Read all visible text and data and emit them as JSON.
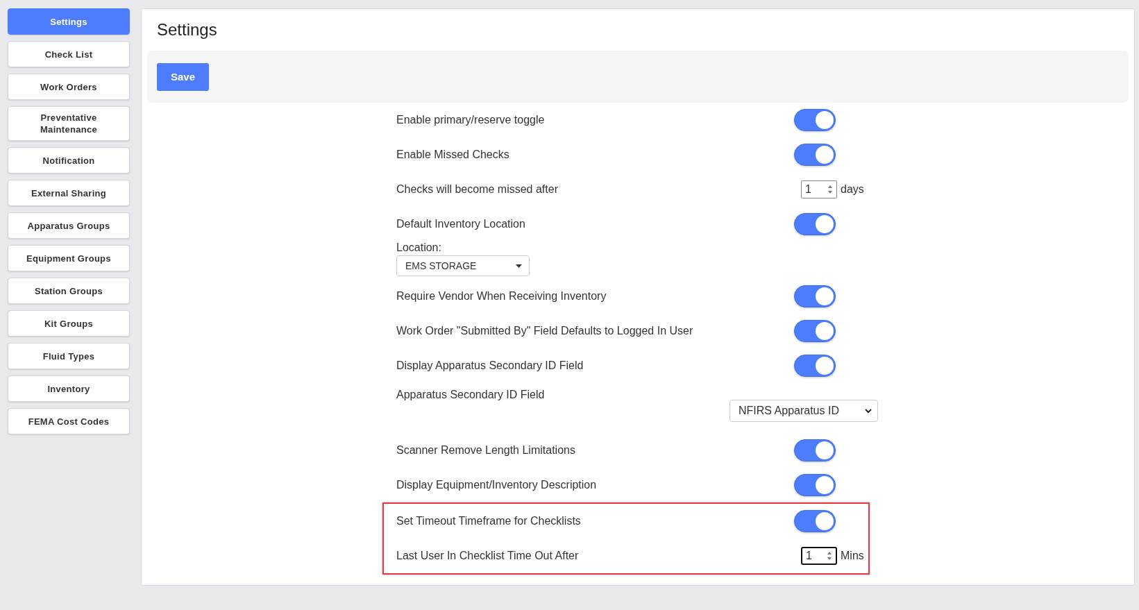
{
  "sidebar": {
    "items": [
      {
        "label": "Settings",
        "selected": true
      },
      {
        "label": "Check List",
        "selected": false
      },
      {
        "label": "Work Orders",
        "selected": false
      },
      {
        "label": "Preventative Maintenance",
        "selected": false
      },
      {
        "label": "Notification",
        "selected": false
      },
      {
        "label": "External Sharing",
        "selected": false
      },
      {
        "label": "Apparatus Groups",
        "selected": false
      },
      {
        "label": "Equipment Groups",
        "selected": false
      },
      {
        "label": "Station Groups",
        "selected": false
      },
      {
        "label": "Kit Groups",
        "selected": false
      },
      {
        "label": "Fluid Types",
        "selected": false
      },
      {
        "label": "Inventory",
        "selected": false
      },
      {
        "label": "FEMA Cost Codes",
        "selected": false
      }
    ]
  },
  "page": {
    "title": "Settings",
    "save_button": "Save"
  },
  "settings": [
    {
      "kind": "toggle",
      "label": "Enable primary/reserve toggle",
      "on": true,
      "highlighted": false
    },
    {
      "kind": "toggle",
      "label": "Enable Missed Checks",
      "on": true,
      "highlighted": false
    },
    {
      "kind": "number",
      "label": "Checks will become missed after",
      "value": "1",
      "unit": "days",
      "focused": false,
      "highlighted": false
    },
    {
      "kind": "toggle",
      "label": "Default Inventory Location",
      "on": true,
      "highlighted": false
    },
    {
      "kind": "dropdown",
      "label": "Location:",
      "value": "EMS STORAGE",
      "highlighted": false
    },
    {
      "kind": "toggle",
      "label": "Require Vendor When Receiving Inventory",
      "on": true,
      "highlighted": false
    },
    {
      "kind": "toggle",
      "label": "Work Order \"Submitted By\" Field Defaults to Logged In User",
      "on": true,
      "highlighted": false
    },
    {
      "kind": "toggle",
      "label": "Display Apparatus Secondary ID Field",
      "on": true,
      "highlighted": false
    },
    {
      "kind": "select",
      "label": "Apparatus Secondary ID Field",
      "value": "NFIRS Apparatus ID",
      "highlighted": false
    },
    {
      "kind": "toggle",
      "label": "Scanner Remove Length Limitations",
      "on": true,
      "highlighted": false
    },
    {
      "kind": "toggle",
      "label": "Display Equipment/Inventory Description",
      "on": true,
      "highlighted": false
    },
    {
      "kind": "toggle",
      "label": "Set Timeout Timeframe for Checklists",
      "on": true,
      "highlighted": true
    },
    {
      "kind": "number",
      "label": "Last User In Checklist Time Out After",
      "value": "1",
      "unit": "Mins",
      "focused": true,
      "highlighted": true
    }
  ]
}
